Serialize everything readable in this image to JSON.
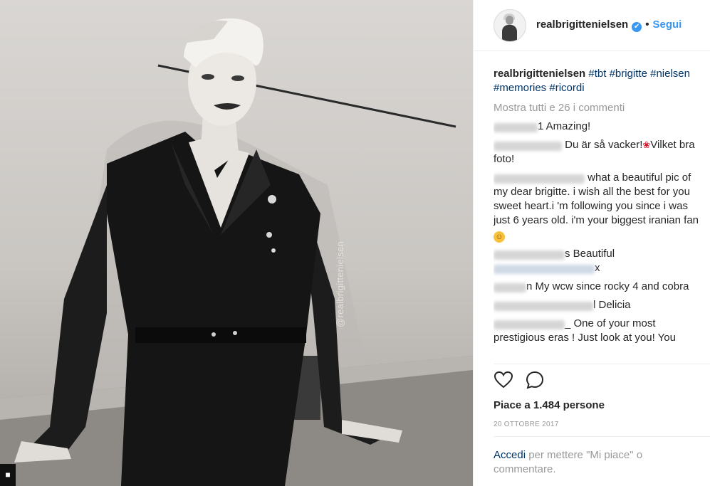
{
  "header": {
    "username": "realbrigittenielsen",
    "verified_glyph": "✔",
    "separator": "•",
    "follow_label": "Segui"
  },
  "media": {
    "watermark": "@realbrigittenielsen",
    "corner_icon": "user-tag-icon"
  },
  "caption": {
    "username": "realbrigittenielsen",
    "hashtags": "#tbt #brigitte #nielsen #memories #ricordi"
  },
  "show_all_comments": "Mostra tutti e 26 i commenti",
  "comments": [
    {
      "username": "xxxxxx",
      "text": "1 Amazing!"
    },
    {
      "username": "xxxxxxxxxxxxx",
      "text": "Du är så vacker!",
      "text_after": "Vilket bra foto!"
    },
    {
      "username": "xxxxxxxxxxxxxxxxxxx",
      "text": "what a beautiful pic of my dear brigitte. i wish all the best for you sweet heart.i 'm following you since i was just 6 years old. i'm your biggest iranian fan"
    },
    {
      "username": "xxxxxxxxxxxx",
      "text": "s Beautiful",
      "mention": "xxxxxxxxxxxxxxxxx",
      "mention_suffix": "x"
    },
    {
      "username": "xxxxxx",
      "text": "n My wcw since rocky 4 and cobra"
    },
    {
      "username": "xxxxxxxxxxxxxxxxxx",
      "text": "l Delicia"
    },
    {
      "username": "xxxxxxxxxxxxx",
      "text": "_ One of your most prestigious eras ! Just look at you! You"
    }
  ],
  "actions": {
    "like_icon": "heart-icon",
    "comment_icon": "comment-icon"
  },
  "likes_text": "Piace a 1.484 persone",
  "date": "20 OTTOBRE 2017",
  "login_prompt": {
    "link": "Accedi",
    "rest": " per mettere \"Mi piace\" o commentare."
  },
  "colors": {
    "link_blue": "#3897f0",
    "hashtag": "#003569",
    "muted": "#999999",
    "text": "#262626",
    "border": "#efefef"
  }
}
